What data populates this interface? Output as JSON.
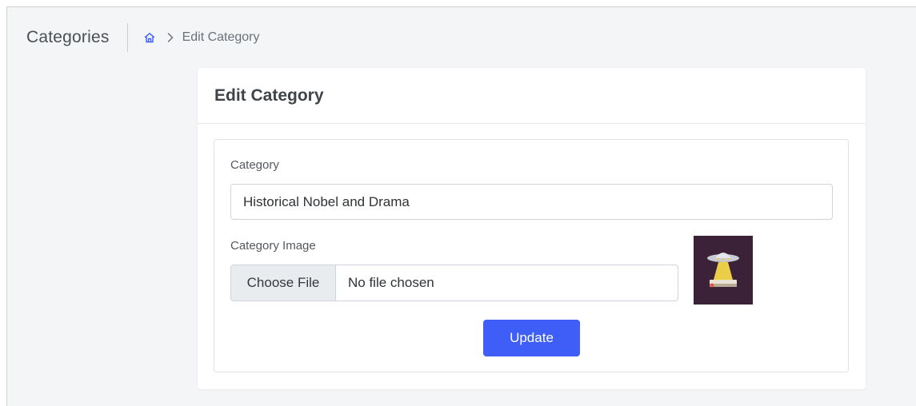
{
  "header": {
    "page_title": "Categories",
    "breadcrumb": {
      "home_icon": "home-icon",
      "separator_icon": "chevron-right-icon",
      "current": "Edit Category"
    }
  },
  "card": {
    "title": "Edit Category",
    "category_field": {
      "label": "Category",
      "value": "Historical Nobel and Drama"
    },
    "image_field": {
      "label": "Category Image",
      "button_label": "Choose File",
      "status": "No file chosen",
      "preview_icon": "ufo-book-thumbnail"
    },
    "update_label": "Update"
  },
  "colors": {
    "accent": "#3f5ef8",
    "home_icon": "#3f5ef8",
    "background": "#f4f5f7",
    "thumbnail_bg": "#3b2238"
  }
}
